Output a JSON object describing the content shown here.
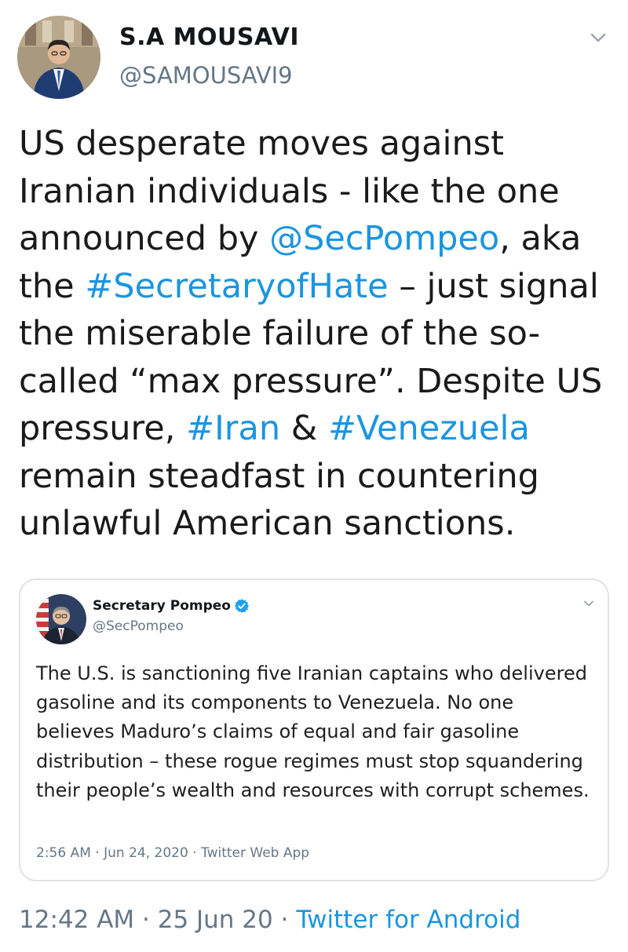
{
  "tweet": {
    "author": {
      "display_name": "S.A MOUSAVI",
      "handle": "@SAMOUSAVI9"
    },
    "text": {
      "p1": "US desperate moves against Iranian individuals - like the one announced by ",
      "mention1": "@SecPompeo",
      "p2": ", aka the ",
      "hashtag1": "#SecretaryofHate",
      "p3": " – just signal the miserable failure of the so-called “max pressure”. Despite US pressure, ",
      "hashtag2": "#Iran",
      "p4": " & ",
      "hashtag3": "#Venezuela",
      "p5": " remain steadfast in countering unlawful American sanctions."
    },
    "timestamp": "12:42 AM",
    "separator": " · ",
    "date": "25 Jun 20",
    "source": "Twitter for Android"
  },
  "quoted": {
    "display_name": "Secretary Pompeo",
    "handle": "@SecPompeo",
    "text": "The U.S. is sanctioning five Iranian captains who delivered gasoline and its components to Venezuela. No one believes Maduro’s claims of equal and fair gasoline distribution – these rogue regimes must stop squandering their people’s wealth and resources with corrupt schemes.",
    "time": "2:56 AM",
    "separator": " · ",
    "date": "Jun 24, 2020",
    "source": "Twitter Web App"
  },
  "icons": {
    "caret": "chevron-down-icon",
    "verified": "verified-badge-icon"
  },
  "colors": {
    "link": "#1b95e0",
    "secondary_text": "#657786",
    "verified": "#1da1f2"
  }
}
